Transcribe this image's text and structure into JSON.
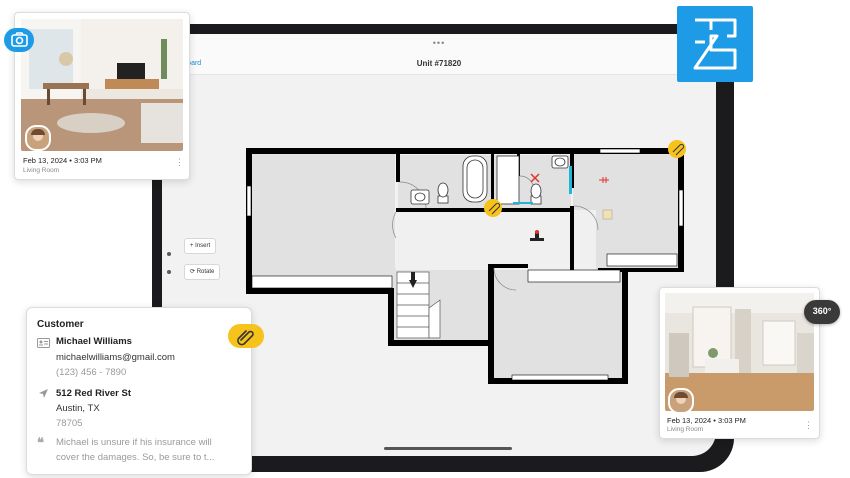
{
  "tablet_app": {
    "nav_back": "ashboard",
    "unit_title": "Unit #71820",
    "top_grabber": "•••",
    "tools": [
      {
        "label": "Insert"
      },
      {
        "label": "Rotate"
      }
    ]
  },
  "photo_cards": [
    {
      "date": "Feb 13, 2024 • 3:03 PM",
      "room": "Living Room"
    },
    {
      "date": "Feb 13, 2024 • 3:03 PM",
      "room": "Living Room"
    }
  ],
  "badges": {
    "panorama_label": "360°"
  },
  "customer": {
    "title": "Customer",
    "name": "Michael Williams",
    "email": "michaelwilliams@gmail.com",
    "phone": "(123) 456 - 7890",
    "street": "512 Red River St",
    "city": "Austin, TX",
    "zip": "78705",
    "note_line1": "Michael is unsure if his insurance will",
    "note_line2": "cover the damages. So, be sure to t..."
  },
  "colors": {
    "accent": "#1e9be6",
    "attachment": "#f6c21c",
    "wall": "#000000",
    "window": "#1fb5d6",
    "alert": "#e0342e"
  },
  "icons": [
    "camera-icon",
    "floorplan-icon",
    "panorama-360-icon",
    "paperclip-icon",
    "id-card-icon",
    "location-arrow-icon",
    "quote-icon",
    "more-vertical-icon",
    "plus-icon",
    "rotate-icon"
  ]
}
